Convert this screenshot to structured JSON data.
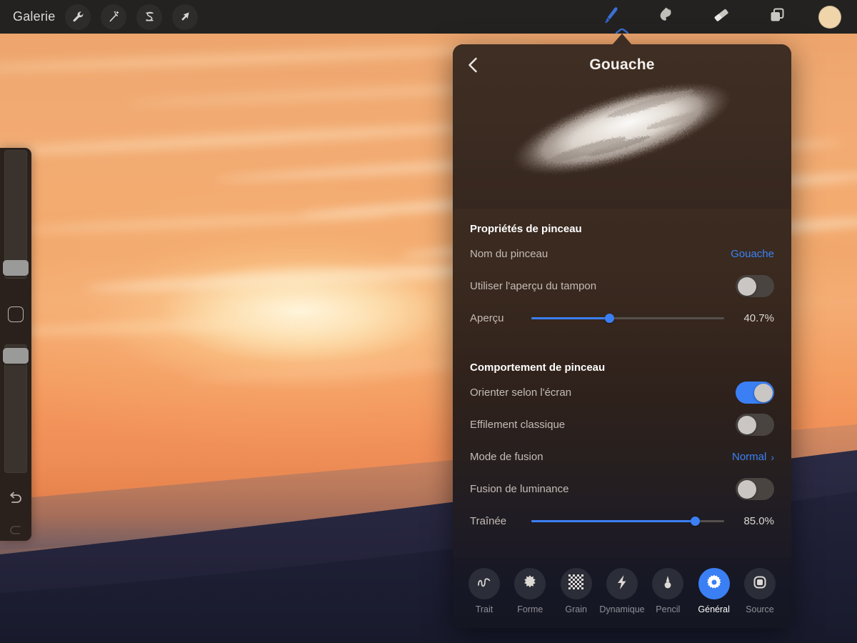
{
  "toolbar": {
    "gallery_label": "Galerie",
    "left_tools": [
      {
        "name": "actions-wrench",
        "icon": "wrench-icon"
      },
      {
        "name": "adjustments-wand",
        "icon": "magic-wand-icon"
      },
      {
        "name": "selection-s",
        "icon": "selection-icon"
      },
      {
        "name": "transform-arrow",
        "icon": "arrow-transform-icon"
      }
    ],
    "right_tools": [
      {
        "name": "paint-brush",
        "icon": "brush-icon",
        "active": true
      },
      {
        "name": "smudge",
        "icon": "smudge-icon",
        "active": false
      },
      {
        "name": "eraser",
        "icon": "eraser-icon",
        "active": false
      },
      {
        "name": "layers",
        "icon": "layers-icon",
        "active": false
      }
    ],
    "color_swatch": "#f0d5ab"
  },
  "sidebar": {
    "brush_size_label": "brush-size-slider",
    "brush_opacity_label": "brush-opacity-slider",
    "modify_label": "modify-button",
    "undo_label": "undo-button",
    "redo_label": "redo-button"
  },
  "panel": {
    "title": "Gouache",
    "back_label": "back",
    "sections": [
      {
        "title": "Propriétés de pinceau",
        "rows": [
          {
            "type": "link",
            "label": "Nom du pinceau",
            "value": "Gouache"
          },
          {
            "type": "toggle",
            "label": "Utiliser l'aperçu du tampon",
            "value": false
          },
          {
            "type": "slider",
            "label": "Aperçu",
            "value": "40.7%",
            "percent": 40.7
          }
        ]
      },
      {
        "title": "Comportement de pinceau",
        "rows": [
          {
            "type": "toggle",
            "label": "Orienter selon l'écran",
            "value": true
          },
          {
            "type": "toggle",
            "label": "Effilement classique",
            "value": false
          },
          {
            "type": "link",
            "label": "Mode de fusion",
            "value": "Normal",
            "chevron": "›"
          },
          {
            "type": "toggle",
            "label": "Fusion de luminance",
            "value": false
          },
          {
            "type": "slider",
            "label": "Traînée",
            "value": "85.0%",
            "percent": 85.0
          }
        ]
      }
    ],
    "tabs": [
      {
        "label": "Trait",
        "icon": "wave-icon",
        "active": false
      },
      {
        "label": "Forme",
        "icon": "burst-icon",
        "active": false
      },
      {
        "label": "Grain",
        "icon": "checker-icon",
        "active": false
      },
      {
        "label": "Dynamique",
        "icon": "lightning-icon",
        "active": false
      },
      {
        "label": "Pencil",
        "icon": "pencil-tip-icon",
        "active": false
      },
      {
        "label": "Général",
        "icon": "gear-icon",
        "active": true
      },
      {
        "label": "Source",
        "icon": "square-icon",
        "active": false
      }
    ]
  },
  "colors": {
    "accent_blue": "#3b7ff5",
    "panel_brown": "#3b2b21",
    "panel_dark": "#151722",
    "toolbar_bg": "#232221"
  }
}
